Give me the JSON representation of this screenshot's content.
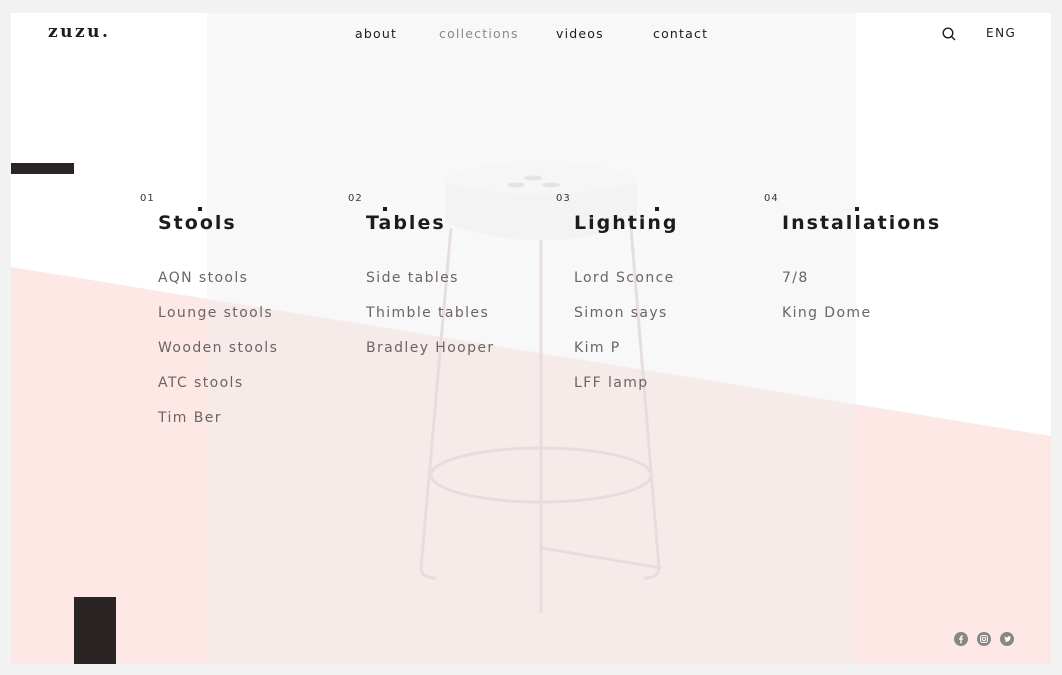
{
  "brand": {
    "logo": "zuzu."
  },
  "nav": {
    "items": [
      {
        "label": "about",
        "active": false
      },
      {
        "label": "collections",
        "active": true
      },
      {
        "label": "videos",
        "active": false
      },
      {
        "label": "contact",
        "active": false
      }
    ],
    "search_icon": "search-icon",
    "language": "ENG"
  },
  "categories": [
    {
      "number": "01",
      "title": "Stools",
      "items": [
        "AQN stools",
        "Lounge stools",
        "Wooden stools",
        "ATC stools",
        "Tim Ber"
      ]
    },
    {
      "number": "02",
      "title": "Tables",
      "items": [
        "Side tables",
        "Thimble tables",
        "Bradley Hooper"
      ]
    },
    {
      "number": "03",
      "title": "Lighting",
      "items": [
        "Lord Sconce",
        "Simon says",
        "Kim P",
        "LFF lamp"
      ]
    },
    {
      "number": "04",
      "title": "Installations",
      "items": [
        "7/8",
        "King Dome"
      ]
    }
  ],
  "social": [
    "facebook-icon",
    "instagram-icon",
    "twitter-icon"
  ],
  "colors": {
    "accent_pink": "#fde8e6",
    "dark": "#2a2424",
    "muted_text": "#6c6464"
  }
}
